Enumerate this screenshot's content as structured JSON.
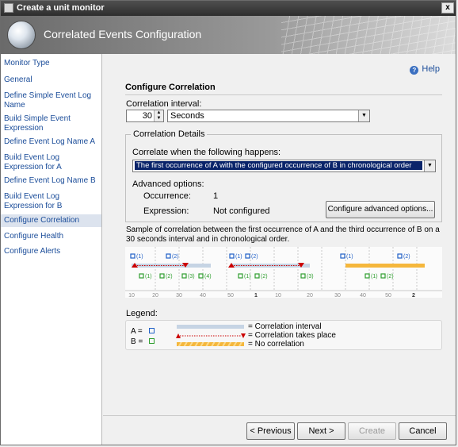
{
  "window": {
    "title": "Create a unit monitor",
    "close_glyph": "x"
  },
  "header": {
    "title": "Correlated Events Configuration"
  },
  "sidebar": {
    "items": [
      {
        "label": "Monitor Type"
      },
      {
        "label": "General"
      },
      {
        "label": "Define Simple Event Log Name"
      },
      {
        "label": "Build Simple Event Expression"
      },
      {
        "label": "Define Event Log Name A"
      },
      {
        "label": "Build Event Log Expression for A"
      },
      {
        "label": "Define Event Log Name B"
      },
      {
        "label": "Build Event Log Expression for B"
      },
      {
        "label": "Configure Correlation",
        "active": true
      },
      {
        "label": "Configure Health"
      },
      {
        "label": "Configure Alerts"
      }
    ]
  },
  "main": {
    "help": "Help",
    "section_title": "Configure Correlation",
    "interval_label": "Correlation interval:",
    "interval_value": "30",
    "interval_unit": "Seconds",
    "details_title": "Correlation Details",
    "correlate_label": "Correlate when the following happens:",
    "correlate_value": "The first occurrence of A with the configured occurrence of B in chronological order",
    "advanced_label": "Advanced options:",
    "occurrence_label": "Occurrence:",
    "occurrence_value": "1",
    "expression_label": "Expression:",
    "expression_value": "Not configured",
    "advanced_button": "Configure advanced options...",
    "sample_text": "Sample of correlation between the first occurrence of A and the third occurrence of B on a 30 seconds interval and in chronological order.",
    "diagram": {
      "a_labels": [
        "(1)",
        "(2)",
        "(1)",
        "(2)",
        "(1)",
        "(2)"
      ],
      "b_labels": [
        "(1)",
        "(2)",
        "(3)",
        "(4)",
        "(1)",
        "(2)",
        "(3)",
        "(1)",
        "(2)"
      ],
      "ticks": [
        "10",
        "20",
        "30",
        "40",
        "50",
        "1",
        "10",
        "20",
        "30",
        "40",
        "50",
        "2"
      ],
      "a_color": "#1f5fc7",
      "b_color": "#2f9e2f",
      "interval_color": "#c6d4e4",
      "arrow_color": "#cc0000",
      "no_corr_color": "#f5b73c"
    },
    "legend_title": "Legend:",
    "legend": {
      "a": "A =",
      "b": "B =",
      "interval": "= Correlation interval",
      "takes_place": "= Correlation takes place",
      "no_corr": "= No correlation"
    }
  },
  "buttons": {
    "previous": "< Previous",
    "next": "Next >",
    "create": "Create",
    "cancel": "Cancel"
  }
}
